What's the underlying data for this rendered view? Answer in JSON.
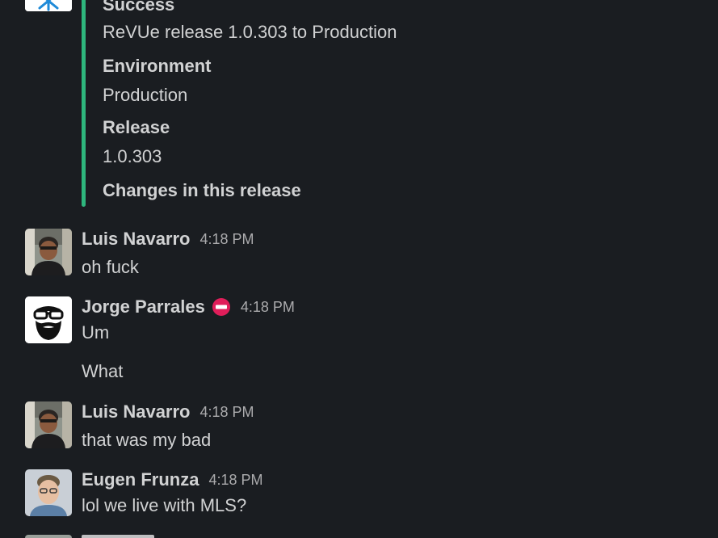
{
  "attachment": {
    "status_title": "Success",
    "status_value": "ReVUe release 1.0.303 to Production",
    "environment_title": "Environment",
    "environment_value": "Production",
    "release_title": "Release",
    "release_value": "1.0.303",
    "changes_title": "Changes in this release",
    "accent_color": "#2eb67d"
  },
  "messages": [
    {
      "sender": "Luis Navarro",
      "time": "4:18 PM",
      "lines": [
        "oh fuck"
      ],
      "avatar": "person-photo-avatar"
    },
    {
      "sender": "Jorge Parrales",
      "status_emoji": "no-entry-icon",
      "time": "4:18 PM",
      "lines": [
        "Um",
        "What"
      ],
      "avatar": "bearded-glasses-avatar"
    },
    {
      "sender": "Luis Navarro",
      "time": "4:18 PM",
      "lines": [
        "that was my bad"
      ],
      "avatar": "person-photo-avatar"
    },
    {
      "sender": "Eugen Frunza",
      "time": "4:18 PM",
      "lines": [
        "lol we live with MLS?"
      ],
      "avatar": "person-photo-avatar"
    }
  ],
  "colors": {
    "background": "#1a1d21",
    "text": "#d1d2d3",
    "timestamp": "#ababad",
    "status_emoji": "#e01e5a"
  }
}
